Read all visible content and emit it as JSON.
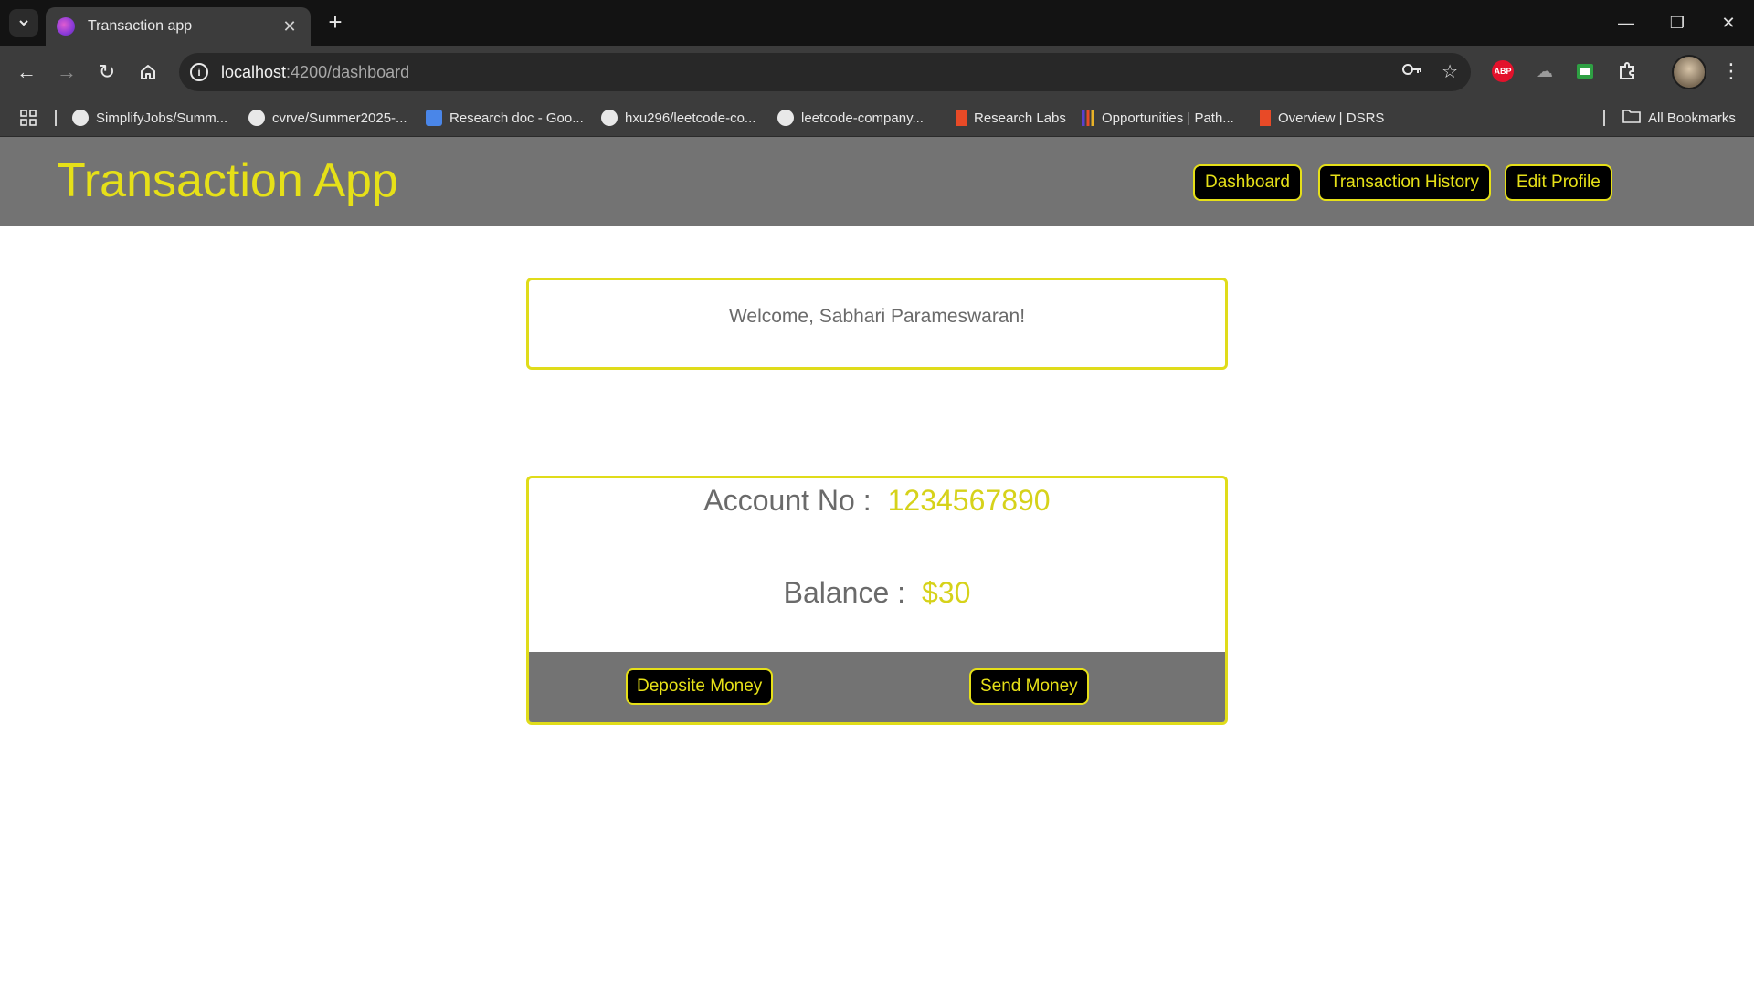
{
  "browser": {
    "tab_title": "Transaction app",
    "url_host": "localhost",
    "url_path": ":4200/dashboard",
    "bookmarks": [
      {
        "label": "SimplifyJobs/Summ...",
        "icon": "github-icon"
      },
      {
        "label": "cvrve/Summer2025-...",
        "icon": "github-icon"
      },
      {
        "label": "Research doc - Goo...",
        "icon": "google-docs-icon"
      },
      {
        "label": "hxu296/leetcode-co...",
        "icon": "github-icon"
      },
      {
        "label": "leetcode-company...",
        "icon": "github-icon"
      },
      {
        "label": "Research Labs",
        "icon": "illinois-icon"
      },
      {
        "label": "Opportunities | Path...",
        "icon": "opportunities-icon"
      },
      {
        "label": "Overview | DSRS",
        "icon": "illinois-icon"
      }
    ],
    "all_bookmarks_label": "All Bookmarks"
  },
  "app": {
    "title": "Transaction App",
    "nav": {
      "dashboard": "Dashboard",
      "history": "Transaction History",
      "profile": "Edit Profile"
    },
    "welcome": "Welcome, Sabhari Parameswaran!",
    "account": {
      "number_label": "Account No :",
      "number_value": "1234567890",
      "balance_label": "Balance :",
      "balance_value": "$30"
    },
    "actions": {
      "deposit": "Deposite Money",
      "send": "Send Money"
    }
  },
  "colors": {
    "accent": "#e6e018",
    "header_bg": "#737373",
    "button_bg": "#000000"
  }
}
